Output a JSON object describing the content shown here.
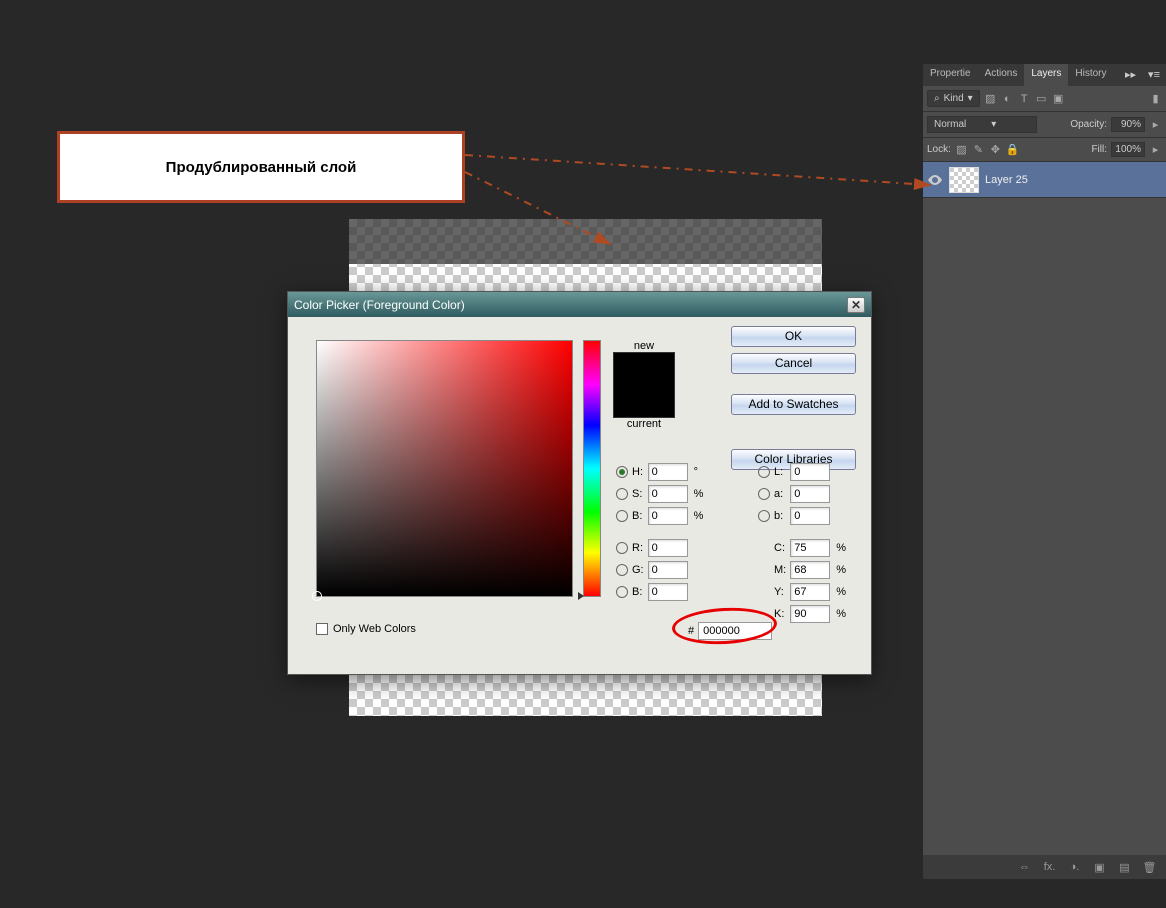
{
  "callout": {
    "text": "Продублированный слой"
  },
  "dialog": {
    "title": "Color Picker (Foreground Color)",
    "close": "✕",
    "labels": {
      "new": "new",
      "current": "current"
    },
    "buttons": {
      "ok": "OK",
      "cancel": "Cancel",
      "swatches": "Add to Swatches",
      "libraries": "Color Libraries"
    },
    "hsb": {
      "h_label": "H:",
      "h": "0",
      "h_unit": "°",
      "s_label": "S:",
      "s": "0",
      "s_unit": "%",
      "b_label": "B:",
      "b": "0",
      "b_unit": "%"
    },
    "rgb": {
      "r_label": "R:",
      "r": "0",
      "g_label": "G:",
      "g": "0",
      "b_label": "B:",
      "b": "0"
    },
    "lab": {
      "l_label": "L:",
      "l": "0",
      "a_label": "a:",
      "a": "0",
      "b_label": "b:",
      "b": "0"
    },
    "cmyk": {
      "c_label": "C:",
      "c": "75",
      "m_label": "M:",
      "m": "68",
      "y_label": "Y:",
      "y": "67",
      "k_label": "K:",
      "k": "90",
      "unit": "%"
    },
    "hex_label": "#",
    "hex": "000000",
    "only_web": "Only Web Colors"
  },
  "panel": {
    "tabs": {
      "properties": "Propertie",
      "actions": "Actions",
      "layers": "Layers",
      "history": "History"
    },
    "kind_label": "Kind",
    "blend": "Normal",
    "opacity_label": "Opacity:",
    "opacity_value": "90%",
    "lock_label": "Lock:",
    "fill_label": "Fill:",
    "fill_value": "100%",
    "layer_name": "Layer 25",
    "footer_icons": {
      "link": "⇔",
      "fx": "fx.",
      "mask": "◑.",
      "group": "▣",
      "new": "▤",
      "trash": "🗑"
    }
  }
}
